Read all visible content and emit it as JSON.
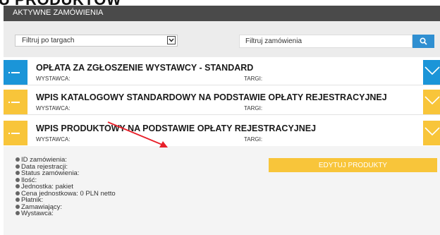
{
  "page_heading": "U PRODUKTÓW",
  "tab": {
    "label": "AKTYWNE ZAMÓWIENIA"
  },
  "filters": {
    "select_value": "Filtruj po targach",
    "search_placeholder": "Filtruj zamówienia"
  },
  "orders": [
    {
      "title": "OPŁATA ZA ZGŁOSZENIE WYSTAWCY - STANDARD",
      "exhibitor_label": "WYSTAWCA:",
      "fair_label": "TARGI:",
      "color": "#1b95d8"
    },
    {
      "title": "WPIS KATALOGOWY STANDARDOWY NA PODSTAWIE OPŁATY REJESTRACYJNEJ",
      "exhibitor_label": "WYSTAWCA:",
      "fair_label": "TARGI:",
      "color": "#f8c53a"
    },
    {
      "title": "WPIS PRODUKTOWY NA PODSTAWIE OPŁATY REJESTRACYJNEJ",
      "exhibitor_label": "WYSTAWCA:",
      "fair_label": "TARGI:",
      "color": "#f8c53a"
    }
  ],
  "details": {
    "rows": [
      "ID zamówienia:",
      "Data rejestracji:",
      "Status zamówienia:",
      "Ilość:",
      "Jednostka: pakiet",
      "Cena jednostkowa: 0 PLN netto",
      "Płatnik:",
      "Zamawiający:",
      "Wystawca:"
    ],
    "edit_button": "EDYTUJ PRODUKTY"
  },
  "colors": {
    "blue": "#1b95d8",
    "yellow": "#f8c53a",
    "annotation_arrow": "#e8202a"
  },
  "icons": [
    "chevron-down-icon",
    "search-icon",
    "list-icon",
    "bullet-icon"
  ]
}
